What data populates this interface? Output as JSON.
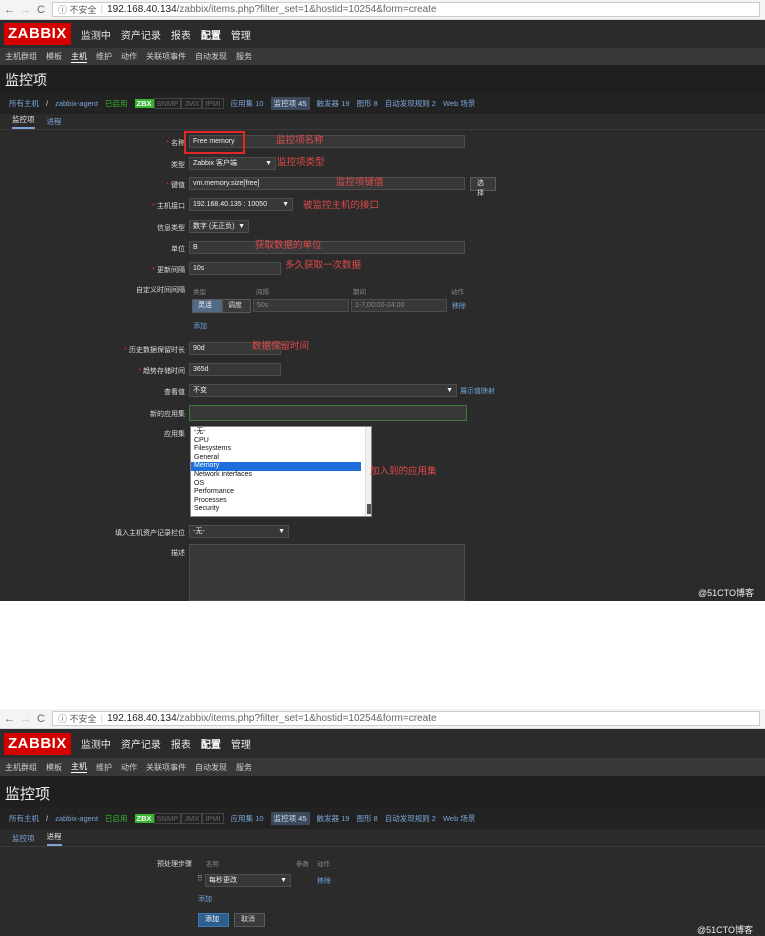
{
  "browser": {
    "back": "←",
    "forward": "→",
    "reload": "C",
    "security": "ⓘ 不安全",
    "host": "192.168.40.134",
    "path": "/zabbix/items.php?filter_set=1&hostid=10254&form=create"
  },
  "header": {
    "logo": "ZABBIX",
    "menu": [
      "监测中",
      "资产记录",
      "报表",
      "配置",
      "管理"
    ],
    "submenu": [
      "主机群组",
      "模板",
      "主机",
      "维护",
      "动作",
      "关联项事件",
      "自动发现",
      "服务"
    ]
  },
  "page": {
    "title": "监控项"
  },
  "filter": {
    "all_hosts": "所有主机",
    "host": "zabbix-agent",
    "enabled": "已启用",
    "zbx": "ZBX",
    "snmp": "SNMP",
    "jmx": "JMX",
    "ipmi": "IPMI",
    "apps": "应用集 10",
    "items": "监控项 45",
    "triggers": "触发器 19",
    "graphs": "图形 8",
    "discovery": "自动发现规则 2",
    "web": "Web 场景"
  },
  "tabs": {
    "item": "监控项",
    "process": "进程"
  },
  "form": {
    "name_label": "名称",
    "name_value": "Free memory",
    "type_label": "类型",
    "type_value": "Zabbix 客户端",
    "key_label": "键值",
    "key_value": "vm.memory.size[free]",
    "key_select_btn": "选择",
    "interface_label": "主机接口",
    "interface_value": "192.168.40.135 : 10050",
    "info_type_label": "信息类型",
    "info_type_value": "数字 (无正负)",
    "units_label": "单位",
    "units_value": "B",
    "interval_label": "更新间隔",
    "interval_value": "10s",
    "custom_interval_label": "自定义时间间隔",
    "custom_cols": {
      "type": "类型",
      "interval": "间隔",
      "period": "期间",
      "action": "动作"
    },
    "custom_flexible": "灵活",
    "custom_scheduling": "调度",
    "custom_interval_value": "50s",
    "custom_period_value": "1-7,00:00-24:00",
    "custom_remove": "移除",
    "custom_add": "添加",
    "history_label": "历史数据保留时长",
    "history_value": "90d",
    "trends_label": "趋势存储时间",
    "trends_value": "365d",
    "valuemap_label": "查看值",
    "valuemap_value": "不变",
    "valuemap_link": "展示值映射",
    "new_app_label": "新的应用集",
    "apps_label": "应用集",
    "apps_options": [
      "-无-",
      "CPU",
      "Filesystems",
      "General",
      "Memory",
      "Network interfaces",
      "OS",
      "Performance",
      "Processes",
      "Security"
    ],
    "apps_selected": "Memory",
    "inventory_label": "填入主机资产记录栏位",
    "inventory_value": "-无-",
    "description_label": "描述"
  },
  "annotations": {
    "name": "监控项名称",
    "type": "监控项类型",
    "key": "监控项键值",
    "interface": "被监控主机的接口",
    "units": "获取数据的单位",
    "interval": "多久获取一次数据",
    "history": "数据保留时间",
    "apps": "加入到的应用集"
  },
  "preprocessing": {
    "steps_label": "预处理步骤",
    "col_name": "名称",
    "col_params": "参数",
    "col_action": "动作",
    "step_value": "每秒更改",
    "remove": "移除",
    "add_link": "添加",
    "add_button": "添加",
    "cancel_button": "取消"
  },
  "watermark": "@51CTO博客",
  "colors": {
    "logo_red": "#d40000",
    "annotation_red": "#e24a4a",
    "link_blue": "#6ea6dc",
    "zbx_green": "#37b52d"
  }
}
